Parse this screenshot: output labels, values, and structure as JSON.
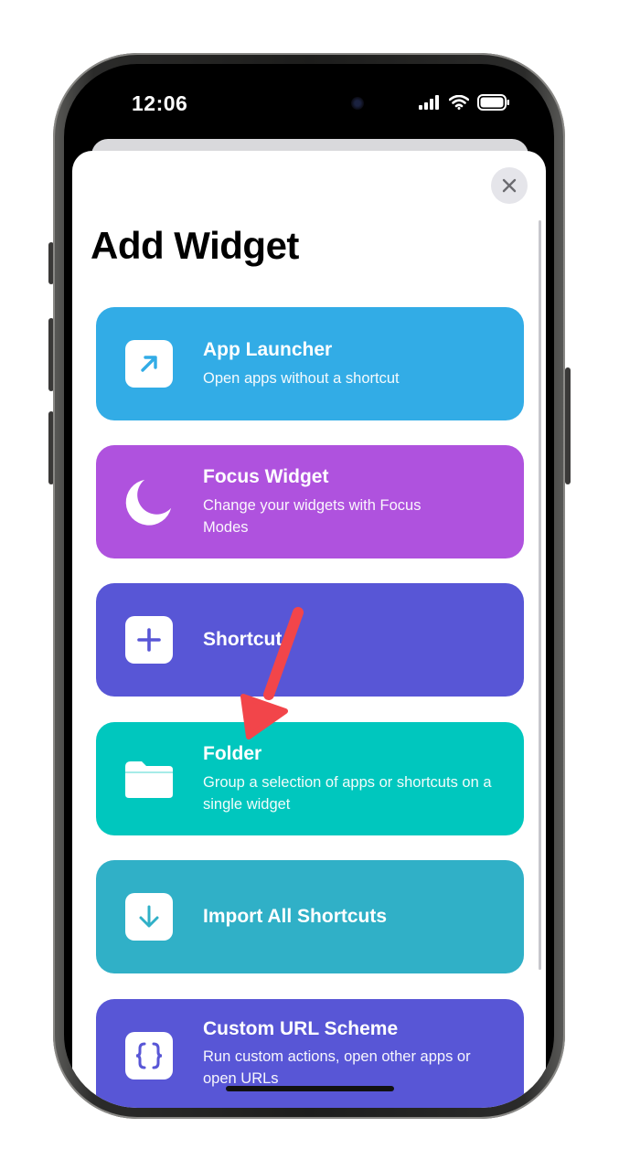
{
  "status_bar": {
    "time": "12:06",
    "icons": [
      "signal-icon",
      "wifi-icon",
      "battery-icon"
    ]
  },
  "sheet": {
    "title": "Add Widget",
    "close_icon": "close-icon"
  },
  "cards": [
    {
      "title": "App Launcher",
      "subtitle": "Open apps without a shortcut",
      "icon": "arrow-up-right-icon",
      "color": "#32ace6"
    },
    {
      "title": "Focus Widget",
      "subtitle": "Change your widgets with Focus Modes",
      "icon": "moon-icon",
      "color": "#af52de"
    },
    {
      "title": "Shortcut",
      "subtitle": "",
      "icon": "plus-icon",
      "color": "#5856d6"
    },
    {
      "title": "Folder",
      "subtitle": "Group a selection of apps or shortcuts on a single widget",
      "icon": "folder-icon",
      "color": "#00c7be"
    },
    {
      "title": "Import All Shortcuts",
      "subtitle": "",
      "icon": "download-arrow-icon",
      "color": "#30b0c7"
    },
    {
      "title": "Custom URL Scheme",
      "subtitle": "Run custom actions, open other apps or open URLs",
      "icon": "braces-icon",
      "color": "#5856d6"
    }
  ],
  "colors": {
    "annotation_arrow": "#f2454a",
    "sheet_background": "#ffffff",
    "close_button_bg": "#e5e5ea"
  }
}
